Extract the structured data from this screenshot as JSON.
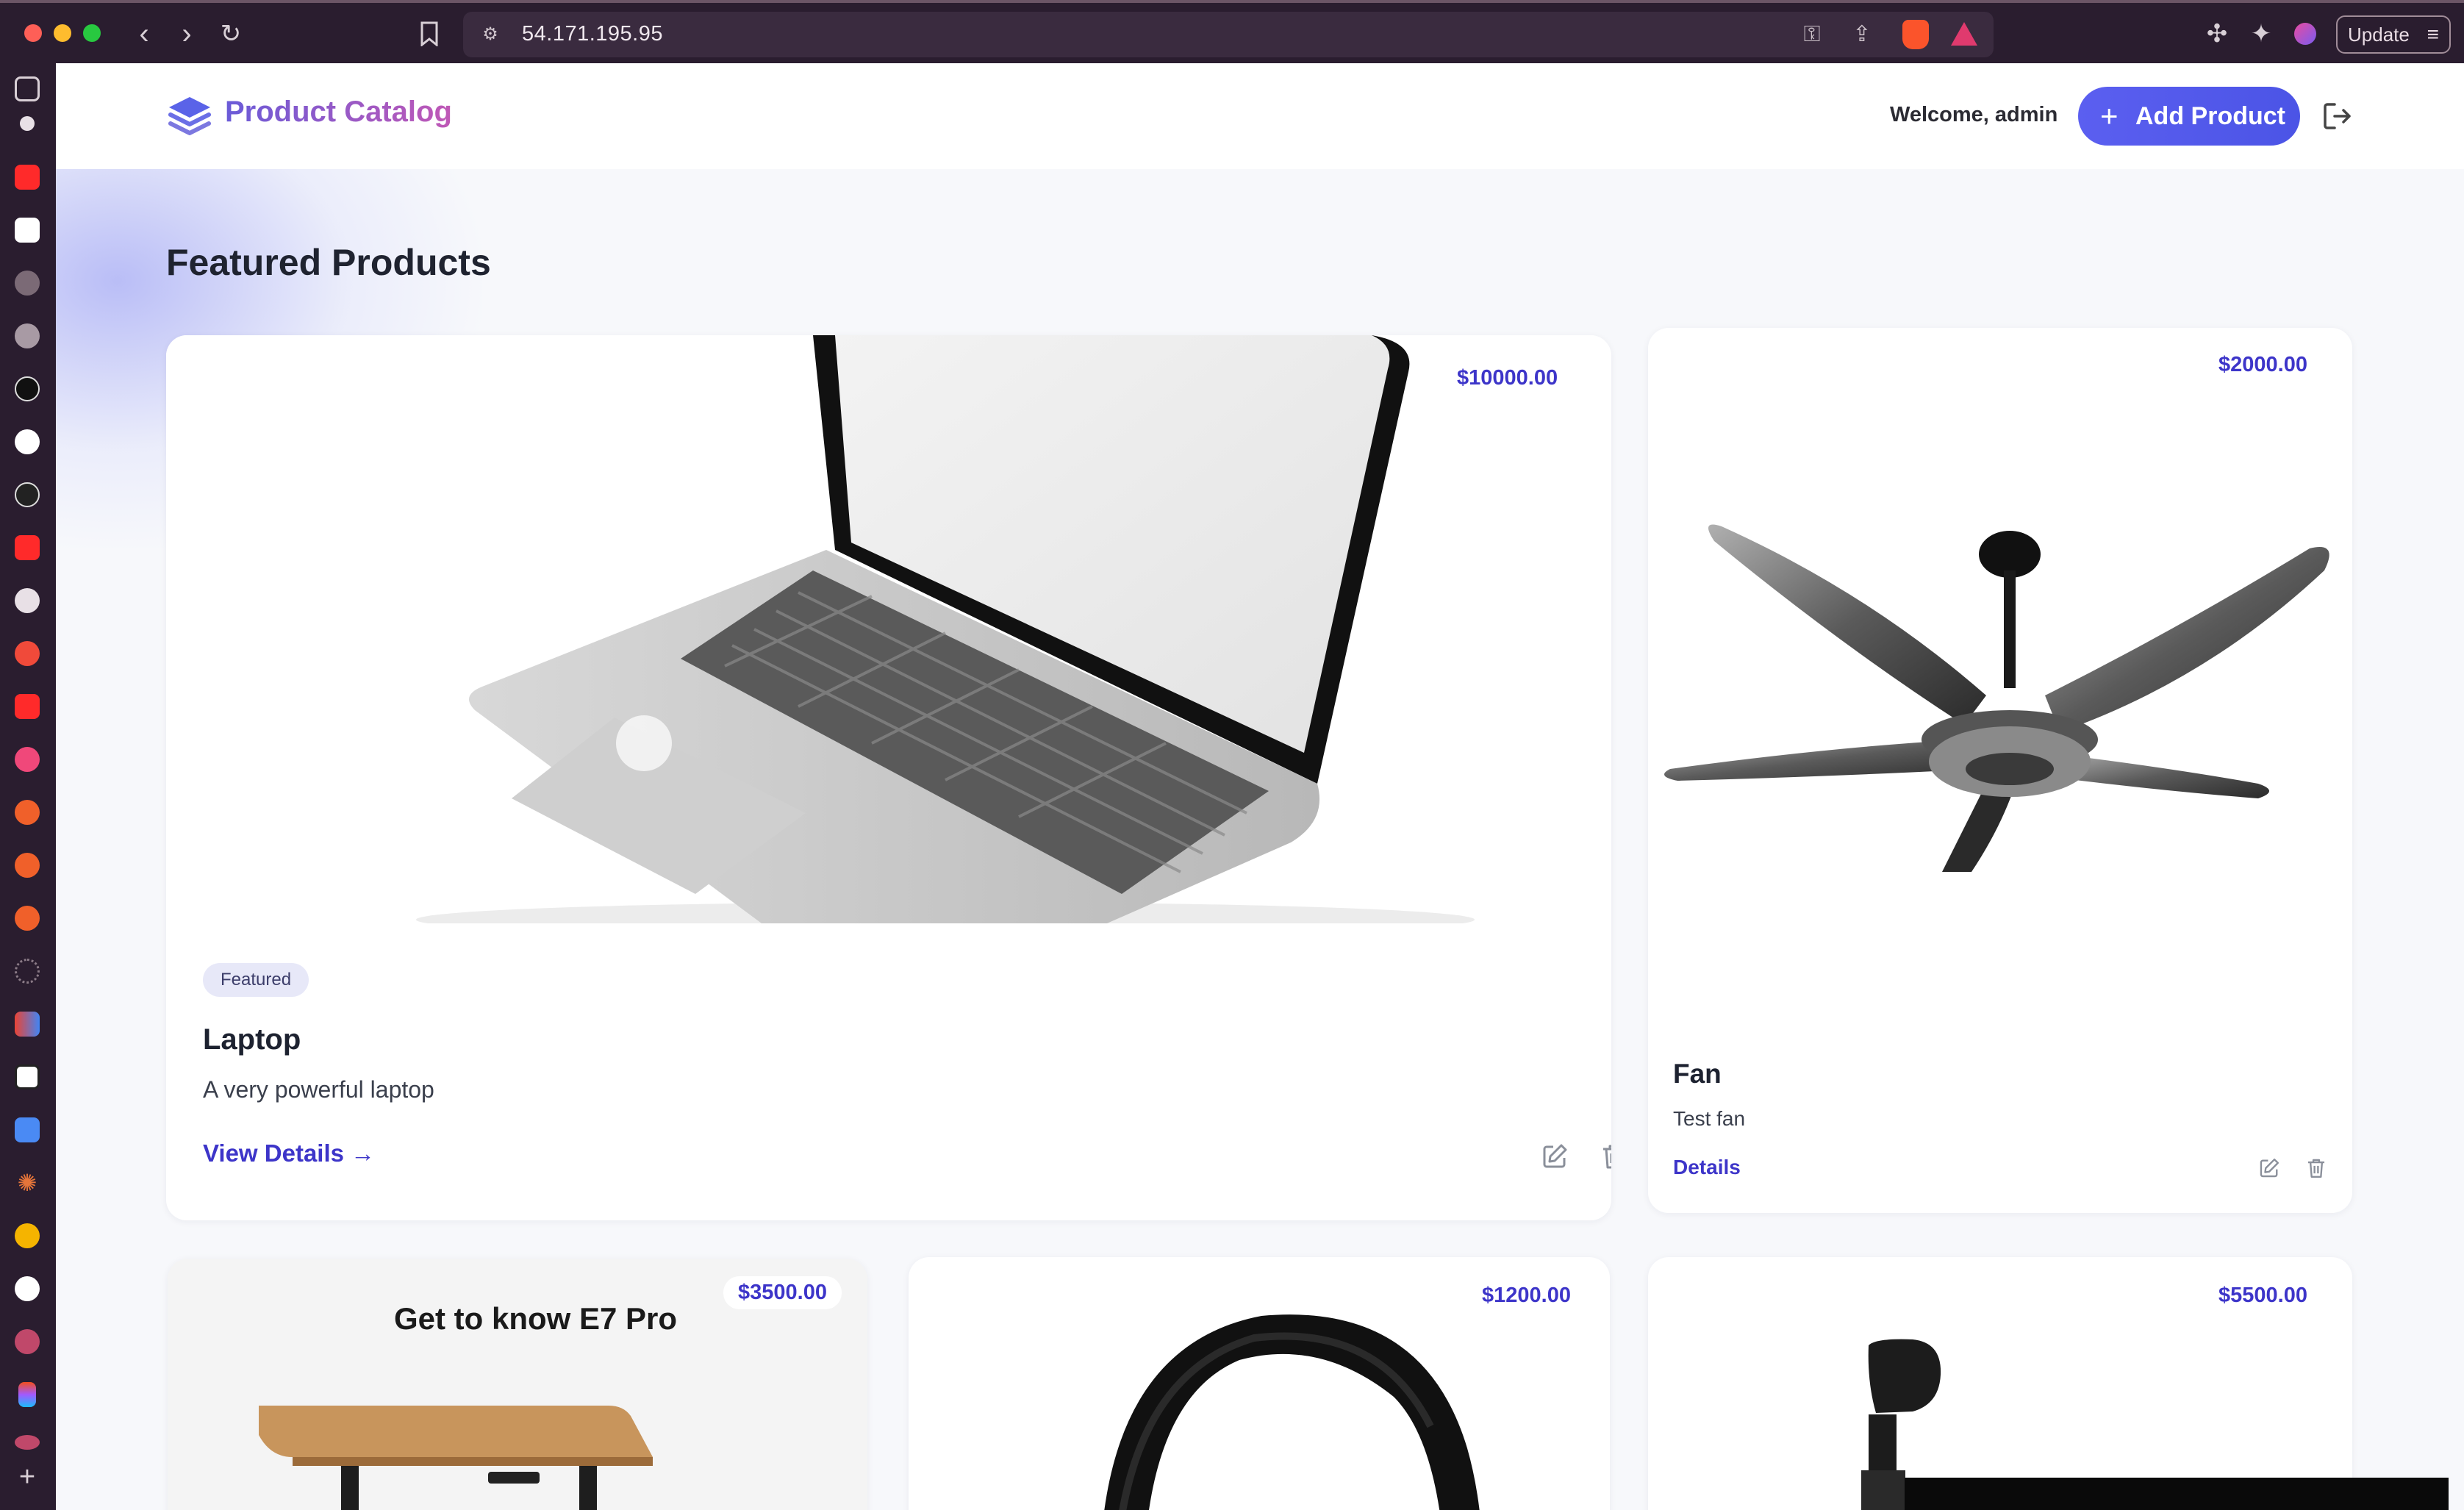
{
  "browser": {
    "url": "54.171.195.95",
    "update_label": "Update"
  },
  "app": {
    "title": "Product Catalog",
    "welcome": "Welcome, admin",
    "add_product_label": "Add Product",
    "section_title": "Featured Products"
  },
  "products": [
    {
      "name": "Laptop",
      "description": "A very powerful laptop",
      "price": "$10000.00",
      "badge": "Featured",
      "link": "View Details →"
    },
    {
      "name": "Fan",
      "description": "Test fan",
      "price": "$2000.00",
      "link": "Details"
    },
    {
      "price": "$3500.00",
      "image_heading": "Get to know E7 Pro"
    },
    {
      "price": "$1200.00"
    },
    {
      "price": "$5500.00"
    }
  ],
  "colors": {
    "accent": "#4b54e6",
    "price": "#3d35c9",
    "chrome": "#2a1d2f"
  },
  "icons": [
    "sidebar-toggle-icon",
    "back-icon",
    "forward-icon",
    "reload-icon",
    "bookmark-icon",
    "site-settings-icon",
    "key-icon",
    "share-icon",
    "brave-shield-icon",
    "brave-rewards-icon",
    "extensions-icon",
    "leo-ai-icon",
    "wallet-icon",
    "menu-icon",
    "layers-logo-icon",
    "plus-icon",
    "logout-icon",
    "edit-icon",
    "trash-icon",
    "arrow-right-icon"
  ]
}
